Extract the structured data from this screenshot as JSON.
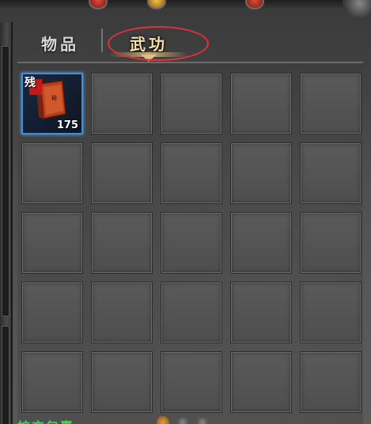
{
  "tabs": {
    "items_label": "物品",
    "martial_label": "武功"
  },
  "inventory": {
    "slots": [
      {
        "filled": true,
        "badge": "残",
        "count": "175",
        "icon": "martial-arts-manual-fragment-icon"
      },
      {
        "filled": false
      },
      {
        "filled": false
      },
      {
        "filled": false
      },
      {
        "filled": false
      },
      {
        "filled": false
      },
      {
        "filled": false
      },
      {
        "filled": false
      },
      {
        "filled": false
      },
      {
        "filled": false
      },
      {
        "filled": false
      },
      {
        "filled": false
      },
      {
        "filled": false
      },
      {
        "filled": false
      },
      {
        "filled": false
      },
      {
        "filled": false
      },
      {
        "filled": false
      },
      {
        "filled": false
      },
      {
        "filled": false
      },
      {
        "filled": false
      },
      {
        "filled": false
      },
      {
        "filled": false
      },
      {
        "filled": false
      },
      {
        "filled": false
      },
      {
        "filled": false
      }
    ]
  },
  "footer": {
    "text": "扩充包裹"
  },
  "colors": {
    "selected_border": "#3f8ed8",
    "highlight_ring": "#e0323a",
    "active_tab_text": "#f3e2a8",
    "footer_text": "#3fd64a"
  }
}
